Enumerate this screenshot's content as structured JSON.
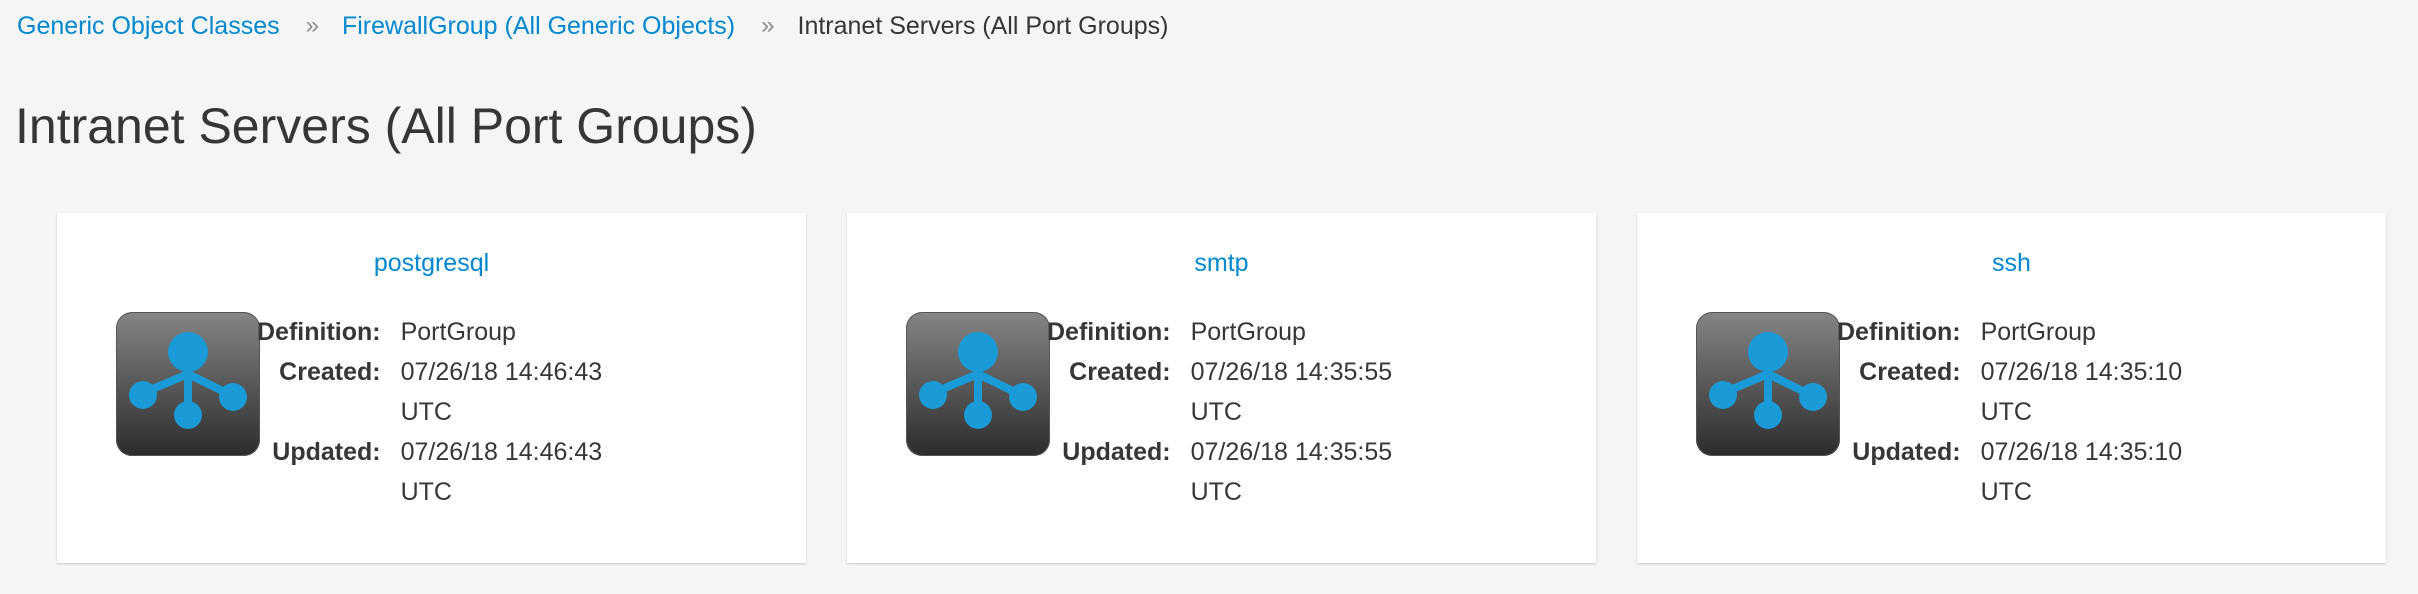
{
  "breadcrumb": {
    "items": [
      {
        "label": "Generic Object Classes"
      },
      {
        "label": "FirewallGroup (All Generic Objects)"
      }
    ],
    "separator": "»",
    "current": "Intranet Servers (All Port Groups)"
  },
  "page": {
    "title": "Intranet Servers (All Port Groups)"
  },
  "colors": {
    "link": "#0088ce",
    "icon_blue": "#1a9ad6",
    "icon_bg_top": "#828282",
    "icon_bg_bottom": "#2e2e2e"
  },
  "cards": [
    {
      "title": "postgresql",
      "icon": "port-group-icon",
      "definition_label": "Definition:",
      "definition": "PortGroup",
      "created_label": "Created:",
      "created": "07/26/18 14:46:43 UTC",
      "updated_label": "Updated:",
      "updated": "07/26/18 14:46:43 UTC"
    },
    {
      "title": "smtp",
      "icon": "port-group-icon",
      "definition_label": "Definition:",
      "definition": "PortGroup",
      "created_label": "Created:",
      "created": "07/26/18 14:35:55 UTC",
      "updated_label": "Updated:",
      "updated": "07/26/18 14:35:55 UTC"
    },
    {
      "title": "ssh",
      "icon": "port-group-icon",
      "definition_label": "Definition:",
      "definition": "PortGroup",
      "created_label": "Created:",
      "created": "07/26/18 14:35:10 UTC",
      "updated_label": "Updated:",
      "updated": "07/26/18 14:35:10 UTC"
    }
  ]
}
